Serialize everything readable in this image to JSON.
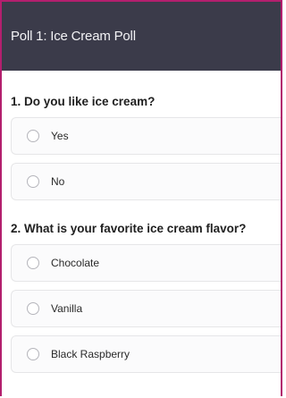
{
  "poll": {
    "title": "Poll 1: Ice Cream Poll",
    "questions": [
      {
        "text": "1. Do you like ice cream?",
        "options": [
          {
            "label": "Yes",
            "selected": false
          },
          {
            "label": "No",
            "selected": false
          }
        ]
      },
      {
        "text": "2. What is your favorite ice cream flavor?",
        "options": [
          {
            "label": "Chocolate",
            "selected": false
          },
          {
            "label": "Vanilla",
            "selected": false
          },
          {
            "label": "Black Raspberry",
            "selected": false
          }
        ]
      }
    ]
  },
  "colors": {
    "header_bg": "#3b3b4a",
    "frame_accent": "#b31f6e"
  },
  "icons": {
    "radio": "radio-unchecked-icon"
  }
}
